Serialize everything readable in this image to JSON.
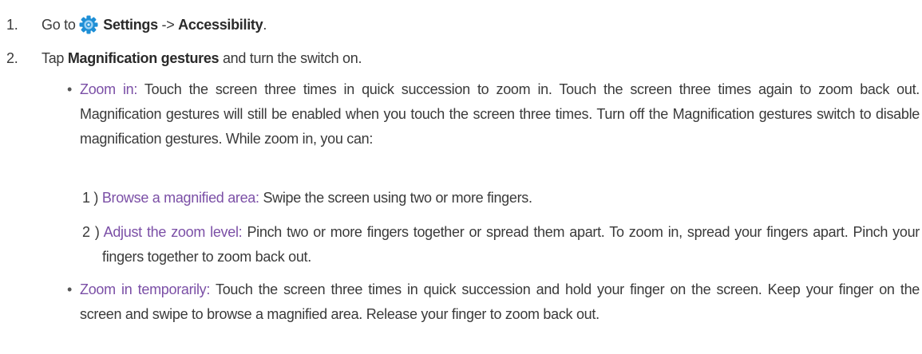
{
  "steps": [
    {
      "num": "1.",
      "prefix": "Go to",
      "icon": "settings-gear-icon",
      "bold1": "Settings",
      "arrow": "->",
      "bold2": "Accessibility",
      "suffix": "."
    },
    {
      "num": "2.",
      "prefix": "Tap",
      "bold1": "Magnification gestures",
      "suffix": "and turn the switch on."
    }
  ],
  "bullets": [
    {
      "mark": "•",
      "term": "Zoom in:",
      "text": "Touch the screen three times in quick succession to zoom in. Touch the screen three times again to zoom back out. Magnification gestures will still be enabled when you touch the screen three times. Turn off the Magnification gestures switch to disable magnification gestures. While zoom in, you can:"
    },
    {
      "mark": "•",
      "term": "Zoom in temporarily:",
      "text": "Touch the screen three times in quick succession and hold your finger on the screen. Keep your finger on the screen and swipe to browse a magnified area. Release your finger to zoom back out."
    }
  ],
  "subitems": [
    {
      "num": "1 )",
      "term": "Browse a magnified area:",
      "text": "Swipe the screen using two or more fingers."
    },
    {
      "num": "2 )",
      "term": "Adjust the zoom level:",
      "text": "Pinch two or more fingers together or spread them apart. To zoom in, spread your fingers apart. Pinch your fingers together to zoom back out."
    }
  ],
  "colors": {
    "term": "#7b4fa6",
    "text": "#3a3a3a",
    "icon_outer": "#1e8fd6",
    "icon_inner": "#9ed3f5"
  }
}
